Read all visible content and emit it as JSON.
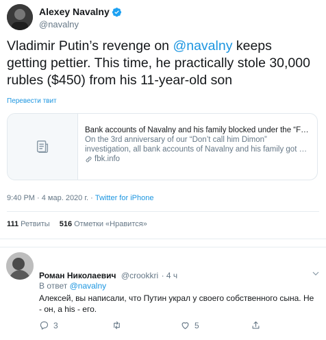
{
  "tweet": {
    "author_name": "Alexey Navalny",
    "author_handle": "@navalny",
    "text_before": "Vladimir Putin’s revenge on ",
    "text_mention": "@navalny",
    "text_after": " keeps getting pettier. This time, he practically stole 30,000 rubles ($450) from his 11-year-old son",
    "translate_label": "Перевести твит",
    "card": {
      "title": "Bank accounts of Navalny and his family blocked under the “F…",
      "description": "On the 3rd anniversary of our “Don’t call him Dimon” investigation, all bank accounts of Navalny and his family got …",
      "domain": "fbk.info"
    },
    "time": "9:40 PM · 4 мар. 2020 г. · ",
    "source": "Twitter for iPhone",
    "retweets_count": "111",
    "retweets_label": "Ретвиты",
    "likes_count": "516",
    "likes_label": "Отметки «Нравится»"
  },
  "reply": {
    "author_name": "Роман Николаевич",
    "author_handle": "@crookkri",
    "time": "· 4 ч",
    "in_reply_prefix": "В ответ ",
    "in_reply_handle": "@navalny",
    "text": "Алексей, вы написали, что Путин украл у своего собственного сына. Не - он, а his - его.",
    "replies_count": "3",
    "retweets_count": "",
    "likes_count": "5"
  },
  "colors": {
    "link": "#1b95e0",
    "secondary": "#657786",
    "border": "#e1e8ed"
  }
}
